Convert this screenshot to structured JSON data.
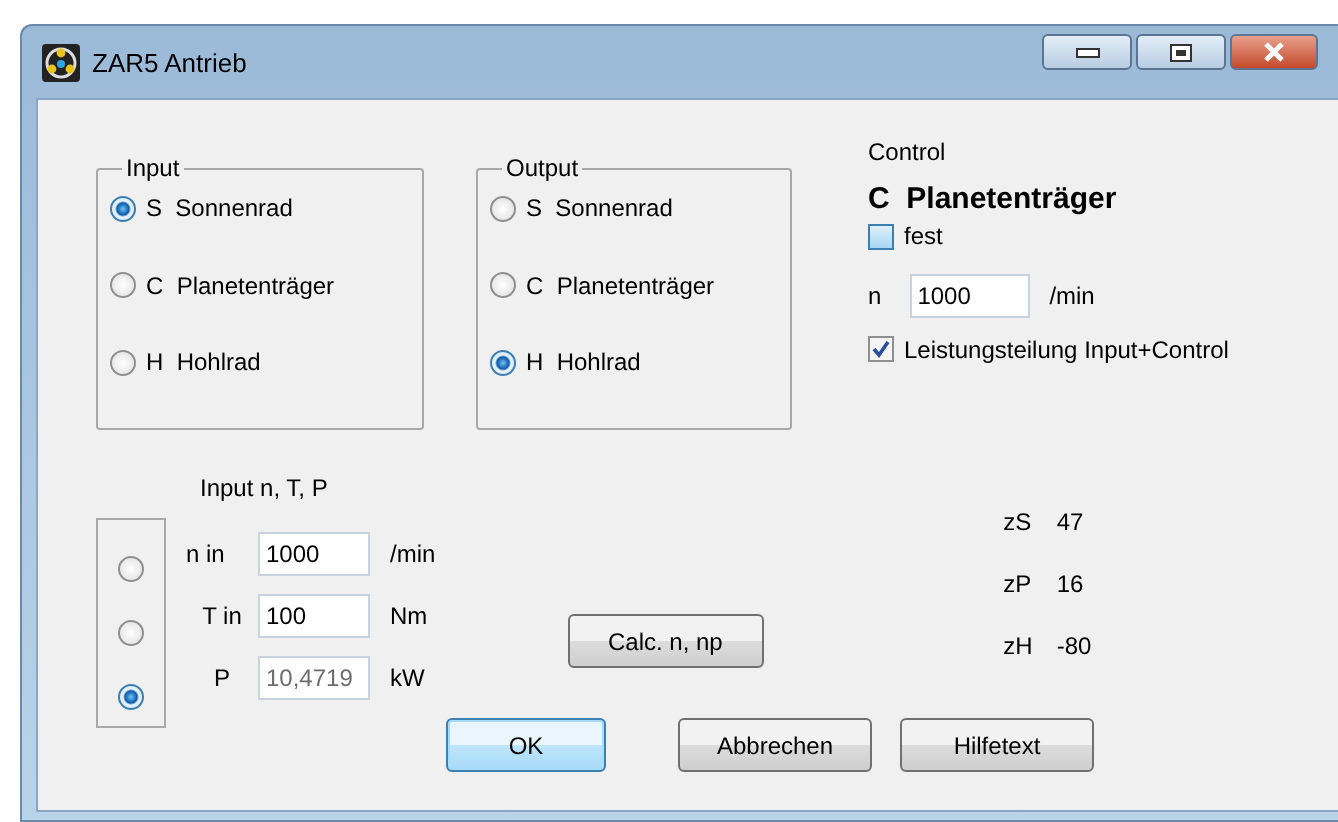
{
  "window": {
    "title": "ZAR5 Antrieb"
  },
  "input": {
    "title": "Input",
    "options": [
      {
        "label": "S  Sonnenrad",
        "selected": true
      },
      {
        "label": "C  Planetenträger",
        "selected": false
      },
      {
        "label": "H  Hohlrad",
        "selected": false
      }
    ]
  },
  "output": {
    "title": "Output",
    "options": [
      {
        "label": "S  Sonnenrad",
        "selected": false
      },
      {
        "label": "C  Planetenträger",
        "selected": false
      },
      {
        "label": "H  Hohlrad",
        "selected": true
      }
    ]
  },
  "control": {
    "title": "Control",
    "member": "C  Planetenträger",
    "fest": {
      "label": "fest",
      "checked": false
    },
    "n": {
      "label": "n",
      "value": "1000",
      "unit": "/min"
    },
    "split": {
      "label": "Leistungsteilung Input+Control",
      "checked": true
    }
  },
  "input_ntp": {
    "title": "Input n, T, P",
    "rows": [
      {
        "label": "n in",
        "value": "1000",
        "unit": "/min",
        "selected": false,
        "disabled": false
      },
      {
        "label": "T in",
        "value": "100",
        "unit": "Nm",
        "selected": false,
        "disabled": false
      },
      {
        "label": "P",
        "value": "10,4719",
        "unit": "kW",
        "selected": true,
        "disabled": true
      }
    ]
  },
  "calc_button": "Calc. n, np",
  "teeth": [
    {
      "label": "zS",
      "value": "47"
    },
    {
      "label": "zP",
      "value": "16"
    },
    {
      "label": "zH",
      "value": "-80"
    }
  ],
  "buttons": [
    {
      "label": "OK",
      "default": true
    },
    {
      "label": "Abbrechen",
      "default": false
    },
    {
      "label": "Hilfetext",
      "default": false
    }
  ]
}
